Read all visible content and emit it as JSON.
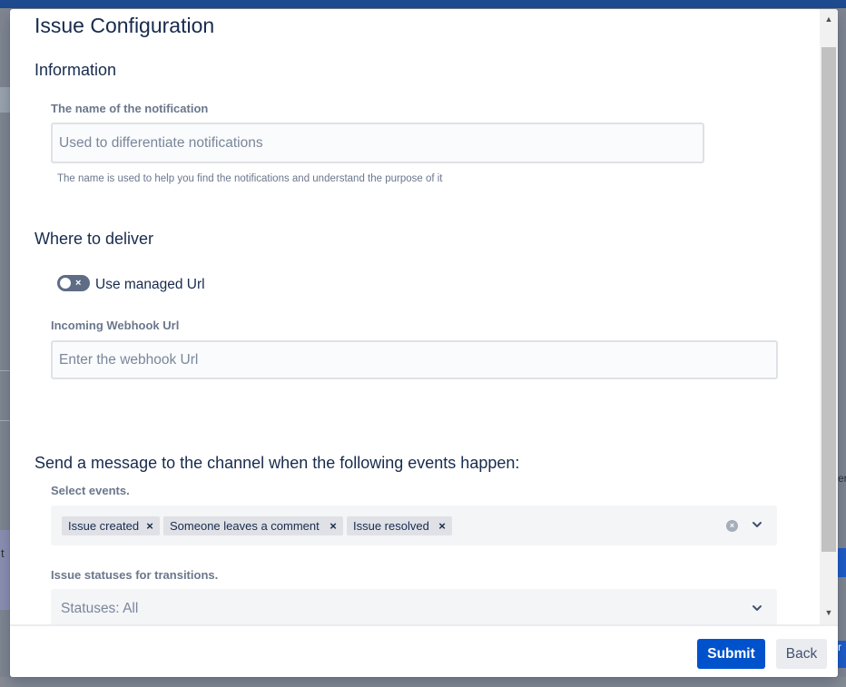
{
  "background": {
    "left_text": "t",
    "right_text": "er",
    "right_button_text": "r"
  },
  "dialog": {
    "title": "Issue Configuration",
    "information": {
      "heading": "Information",
      "name_label": "The name of the notification",
      "name_placeholder": "Used to differentiate notifications",
      "name_value": "",
      "name_helper": "The name is used to help you find the notifications and understand the purpose of it"
    },
    "delivery": {
      "heading": "Where to deliver",
      "toggle_label": "Use managed Url",
      "toggle_on": false,
      "webhook_label": "Incoming Webhook Url",
      "webhook_placeholder": "Enter the webhook Url",
      "webhook_value": ""
    },
    "events": {
      "heading": "Send a message to the channel when the following events happen:",
      "select_label": "Select events.",
      "selected": [
        "Issue created",
        "Someone leaves a comment",
        "Issue resolved"
      ],
      "statuses_label": "Issue statuses for transitions.",
      "statuses_value": "Statuses: All"
    },
    "footer": {
      "submit_label": "Submit",
      "back_label": "Back"
    }
  },
  "icons": {
    "remove": "×",
    "clear": "×",
    "toggle_off": "×",
    "scroll_up": "▲",
    "scroll_down": "▼"
  },
  "colors": {
    "primary": "#0052cc",
    "text": "#172b4d",
    "subtle": "#6b778c",
    "toggle_off": "#5e6c84"
  }
}
